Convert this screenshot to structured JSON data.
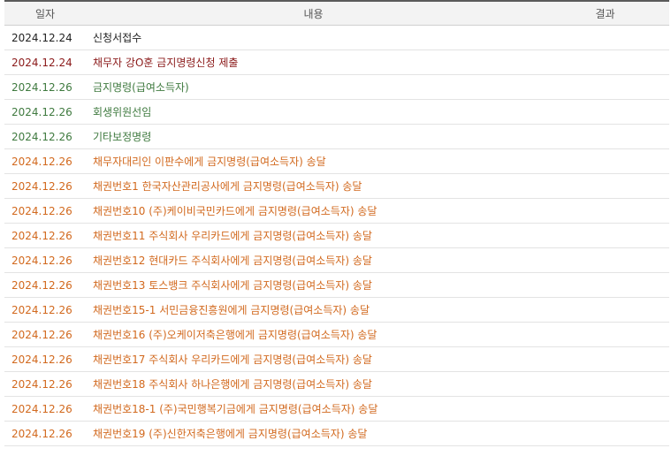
{
  "header": {
    "date": "일자",
    "content": "내용",
    "result": "결과"
  },
  "rows": [
    {
      "date": "2024.12.24",
      "content": "신청서접수",
      "result": "",
      "color": "#222222"
    },
    {
      "date": "2024.12.24",
      "content": "채무자 강O훈 금지명령신청 제출",
      "result": "",
      "color": "#8b1a1a"
    },
    {
      "date": "2024.12.26",
      "content": "금지명령(급여소득자)",
      "result": "",
      "color": "#3f7a3f"
    },
    {
      "date": "2024.12.26",
      "content": "회생위원선임",
      "result": "",
      "color": "#3f7a3f"
    },
    {
      "date": "2024.12.26",
      "content": "기타보정명령",
      "result": "",
      "color": "#3f7a3f"
    },
    {
      "date": "2024.12.26",
      "content": "채무자대리인 이판수에게 금지명령(급여소득자) 송달",
      "result": "",
      "color": "#d2691e"
    },
    {
      "date": "2024.12.26",
      "content": "채권번호1 한국자산관리공사에게 금지명령(급여소득자) 송달",
      "result": "",
      "color": "#d2691e"
    },
    {
      "date": "2024.12.26",
      "content": "채권번호10 (주)케이비국민카드에게 금지명령(급여소득자) 송달",
      "result": "",
      "color": "#d2691e"
    },
    {
      "date": "2024.12.26",
      "content": "채권번호11 주식회사 우리카드에게 금지명령(급여소득자) 송달",
      "result": "",
      "color": "#d2691e"
    },
    {
      "date": "2024.12.26",
      "content": "채권번호12 현대카드 주식회사에게 금지명령(급여소득자) 송달",
      "result": "",
      "color": "#d2691e"
    },
    {
      "date": "2024.12.26",
      "content": "채권번호13 토스뱅크 주식회사에게 금지명령(급여소득자) 송달",
      "result": "",
      "color": "#d2691e"
    },
    {
      "date": "2024.12.26",
      "content": "채권번호15-1 서민금융진흥원에게 금지명령(급여소득자) 송달",
      "result": "",
      "color": "#d2691e"
    },
    {
      "date": "2024.12.26",
      "content": "채권번호16 (주)오케이저축은행에게 금지명령(급여소득자) 송달",
      "result": "",
      "color": "#d2691e"
    },
    {
      "date": "2024.12.26",
      "content": "채권번호17 주식회사 우리카드에게 금지명령(급여소득자) 송달",
      "result": "",
      "color": "#d2691e"
    },
    {
      "date": "2024.12.26",
      "content": "채권번호18 주식회사 하나은행에게 금지명령(급여소득자) 송달",
      "result": "",
      "color": "#d2691e"
    },
    {
      "date": "2024.12.26",
      "content": "채권번호18-1 (주)국민행복기금에게 금지명령(급여소득자) 송달",
      "result": "",
      "color": "#d2691e"
    },
    {
      "date": "2024.12.26",
      "content": "채권번호19 (주)신한저축은행에게 금지명령(급여소득자) 송달",
      "result": "",
      "color": "#d2691e"
    }
  ]
}
